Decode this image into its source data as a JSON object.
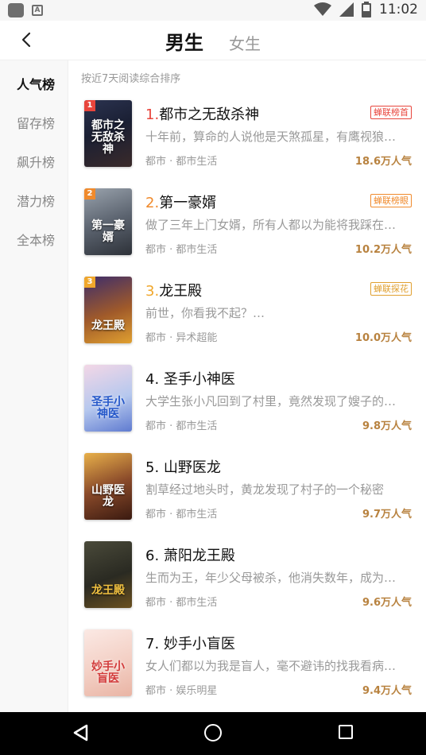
{
  "status_bar": {
    "time": "11:02"
  },
  "header": {
    "tab_male": "男生",
    "tab_female": "女生"
  },
  "sidenav": {
    "items": [
      "人气榜",
      "留存榜",
      "飙升榜",
      "潜力榜",
      "全本榜"
    ],
    "active_index": 0
  },
  "subtitle": "按近7天阅读综合排序",
  "colors": {
    "rank1": "#e8453c",
    "rank2": "#f08a2c",
    "rank3": "#f0a72c",
    "popularity": "#b8823f"
  },
  "books": [
    {
      "rank": "1",
      "rank_label": "1.",
      "title": "都市之无敌杀神",
      "cover_text": "都市之无敌杀神",
      "tag": "蝉联榜首",
      "desc": "十年前，算命的人说他是天煞孤星，有鹰视狼…",
      "meta": "都市 · 都市生活",
      "pop": "18.6万人气"
    },
    {
      "rank": "2",
      "rank_label": "2.",
      "title": "第一豪婿",
      "cover_text": "第一豪婿",
      "tag": "蝉联榜眼",
      "desc": "做了三年上门女婿，所有人都以为能将我踩在…",
      "meta": "都市 · 都市生活",
      "pop": "10.2万人气"
    },
    {
      "rank": "3",
      "rank_label": "3.",
      "title": "龙王殿",
      "cover_text": "龙王殿",
      "tag": "蝉联探花",
      "desc": "前世，你看我不起？…",
      "meta": "都市 · 异术超能",
      "pop": "10.0万人气"
    },
    {
      "rank": "",
      "rank_label": "4.",
      "title": "圣手小神医",
      "cover_text": "圣手小神医",
      "tag": "",
      "desc": "大学生张小凡回到了村里，竟然发现了嫂子的…",
      "meta": "都市 · 都市生活",
      "pop": "9.8万人气"
    },
    {
      "rank": "",
      "rank_label": "5.",
      "title": "山野医龙",
      "cover_text": "山野医龙",
      "tag": "",
      "desc": "割草经过地头时，黄龙发现了村子的一个秘密",
      "meta": "都市 · 都市生活",
      "pop": "9.7万人气"
    },
    {
      "rank": "",
      "rank_label": "6.",
      "title": "萧阳龙王殿",
      "cover_text": "龙王殿",
      "tag": "",
      "desc": "生而为王，年少父母被杀，他消失数年，成为…",
      "meta": "都市 · 都市生活",
      "pop": "9.6万人气"
    },
    {
      "rank": "",
      "rank_label": "7.",
      "title": "妙手小盲医",
      "cover_text": "妙手小盲医",
      "tag": "",
      "desc": "女人们都以为我是盲人，毫不避讳的找我看病…",
      "meta": "都市 · 娱乐明星",
      "pop": "9.4万人气"
    }
  ]
}
